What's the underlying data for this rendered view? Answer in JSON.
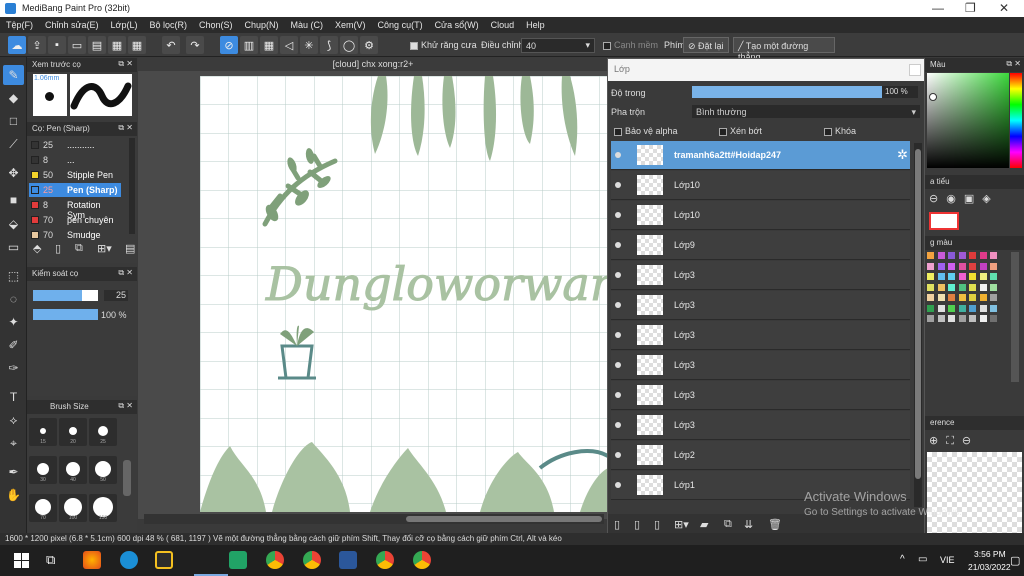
{
  "window": {
    "title": "MediBang Paint Pro (32bit)",
    "minimize": "—",
    "maximize": "❐",
    "close": "✕"
  },
  "menu": [
    "Tệp(F)",
    "Chỉnh sửa(E)",
    "Lớp(L)",
    "Bộ lọc(R)",
    "Chọn(S)",
    "Chụp(N)",
    "Màu (C)",
    "Xem(V)",
    "Công cụ(T)",
    "Cửa sổ(W)",
    "Cloud",
    "Help"
  ],
  "toolbar": {
    "antialias": "Khử răng cưa",
    "adjust_label": "Điều chỉnh",
    "adjust_value": "40",
    "edge_mem": "Cạnh mềm",
    "key_label": "Phím",
    "set_key": "Đặt lại",
    "straight_line": "Tạo một đường thẳng"
  },
  "brush_preview": {
    "header": "Xem trước cọ",
    "size": "1.06mm"
  },
  "brush_list": {
    "header": "Cọ: Pen (Sharp)",
    "items": [
      {
        "size": "25",
        "name": "...........",
        "color": "#333333"
      },
      {
        "size": "8",
        "name": "...",
        "color": "#333333"
      },
      {
        "size": "50",
        "name": "Stipple Pen",
        "color": "#f2d22a"
      },
      {
        "size": "25",
        "name": "Pen (Sharp)",
        "color": "#3d8be0"
      },
      {
        "size": "8",
        "name": "Rotation Sym",
        "color": "#e23b3b"
      },
      {
        "size": "70",
        "name": "pen chuyên",
        "color": "#e23b3b"
      },
      {
        "size": "70",
        "name": "Smudge",
        "color": "#e8c8a0"
      }
    ]
  },
  "brush_control": {
    "header": "Kiểm soát cọ",
    "size_value": "25",
    "opacity_value": "100 %",
    "size_fill": 0.75,
    "opacity_fill": 1.0
  },
  "brush_size": {
    "header": "Brush Size",
    "sizes": [
      "15",
      "20",
      "25",
      "30",
      "40",
      "50",
      "70",
      "100",
      "150"
    ]
  },
  "canvas": {
    "tab_title": "[cloud] chx xong:r2+",
    "text_art": "Dungloworwamalsaeu"
  },
  "layers": {
    "header": "Lớp",
    "opacity_label": "Độ trong",
    "opacity_value": "100 %",
    "blend_label": "Pha trộn",
    "blend_value": "Bình thường",
    "protect_alpha": "Bảo vệ alpha",
    "clip": "Xén bớt",
    "lock": "Khóa",
    "items": [
      "tramanh6a2tt#Hoidap247",
      "Lớp10",
      "Lớp10",
      "Lớp9",
      "Lớp3",
      "Lớp3",
      "Lớp3",
      "Lớp3",
      "Lớp3",
      "Lớp3",
      "Lớp2",
      "Lớp1"
    ]
  },
  "right": {
    "color_header": "Màu",
    "nav_header": "a tiểu",
    "palette_header": "g màu",
    "ref_header": "erence"
  },
  "status": "1600 * 1200 pixel   (6.8 * 5.1cm)   600 dpi   48 %   ( 681, 1197 )   Vẽ một đường thẳng bằng cách giữ phím Shift, Thay đổi cỡ cọ bằng cách giữ phím Ctrl, Alt và kéo",
  "activate": {
    "line1": "Activate Windows",
    "line2": "Go to Settings to activate Windows."
  },
  "taskbar": {
    "time": "3:56 PM",
    "date": "21/03/2022",
    "lang": "VIE"
  },
  "colors": {
    "accent": "#3d8be0",
    "selected_layer": "#5b9bd5",
    "plant": "#9db897"
  }
}
